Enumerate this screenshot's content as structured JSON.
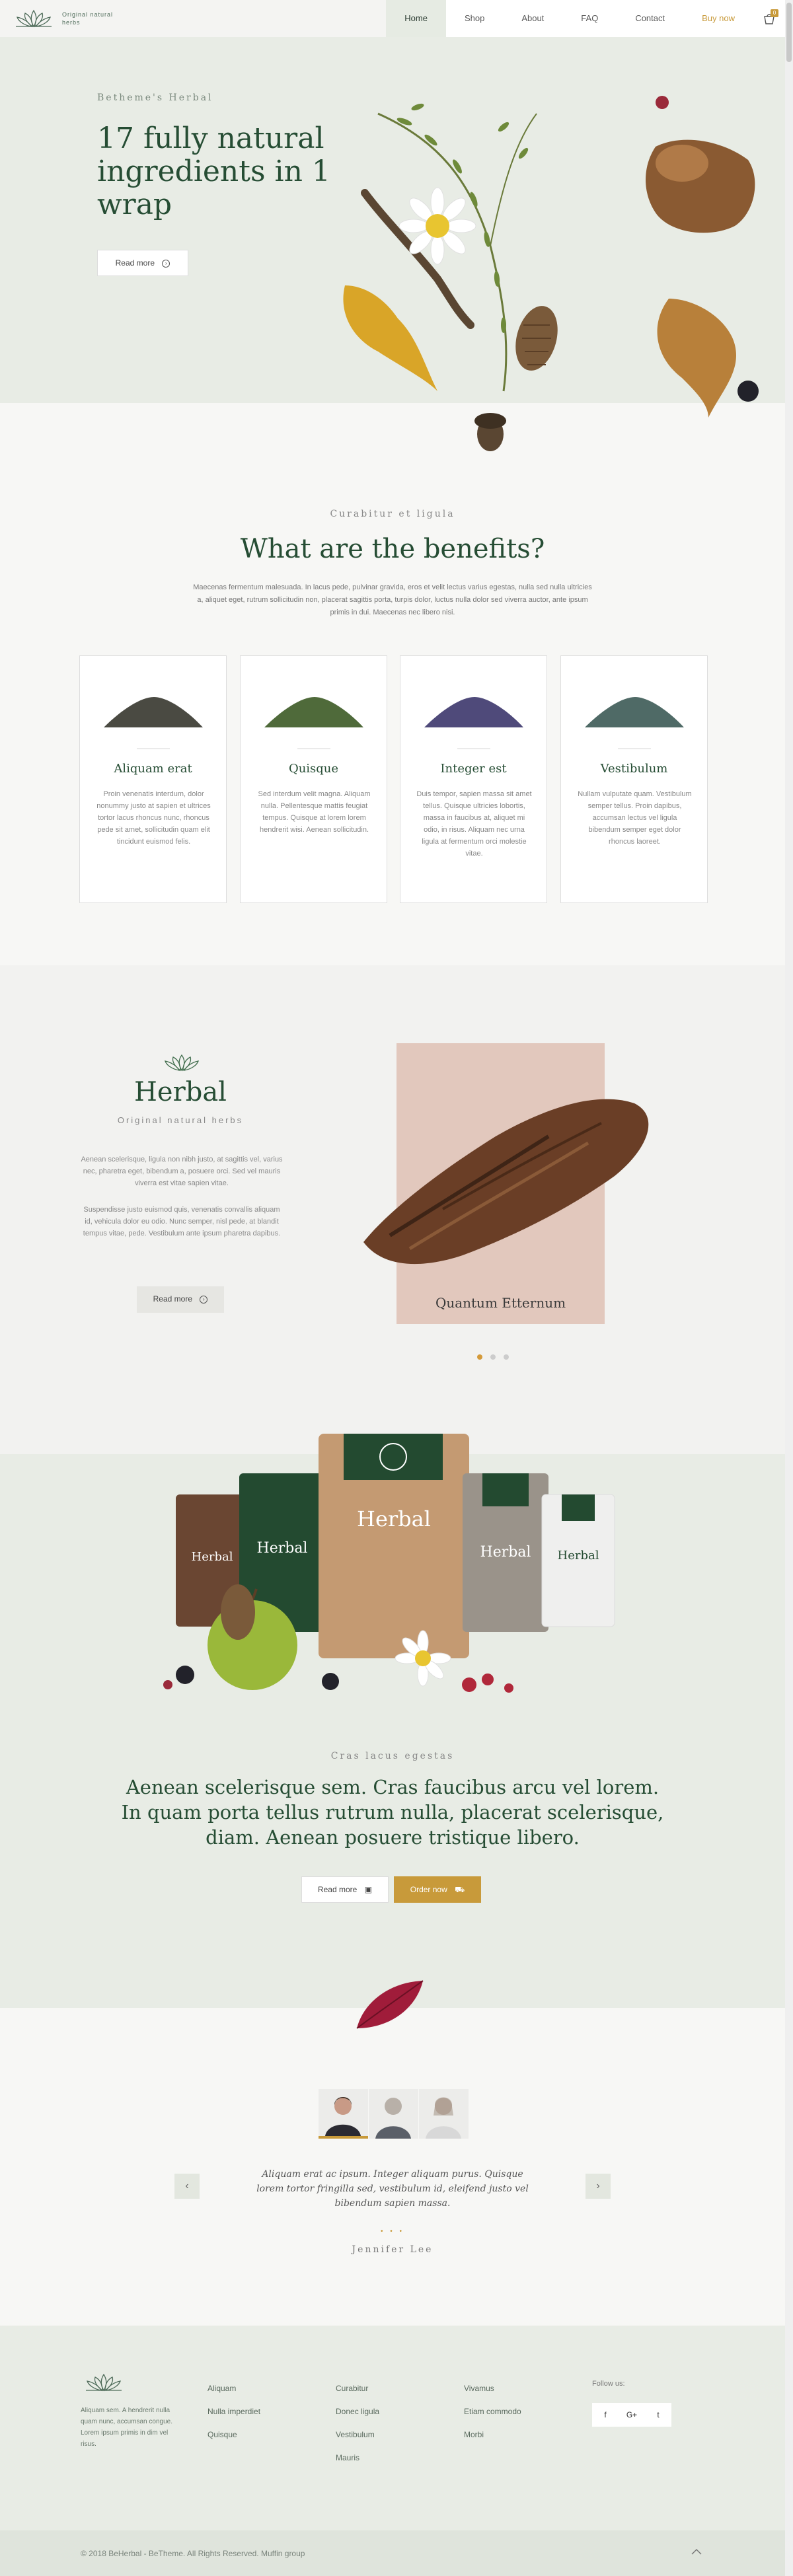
{
  "header": {
    "logo_text": "Original natural herbs",
    "nav": [
      "Home",
      "Shop",
      "About",
      "FAQ",
      "Contact",
      "Buy now"
    ],
    "cart_count": "0"
  },
  "hero": {
    "kicker": "Betheme's Herbal",
    "title": "17 fully natural ingredients in 1 wrap",
    "button": "Read more"
  },
  "benefits": {
    "kicker": "Curabitur et ligula",
    "title": "What are the benefits?",
    "description": "Maecenas fermentum malesuada. In lacus pede, pulvinar gravida, eros et velit lectus varius egestas, nulla sed nulla ultricies a, aliquet eget, rutrum sollicitudin non, placerat sagittis porta, turpis dolor, luctus nulla dolor sed viverra auctor, ante ipsum primis in dui. Maecenas nec libero nisi.",
    "cards": [
      {
        "title": "Aliquam erat",
        "text": "Proin venenatis interdum, dolor nonummy justo at sapien et ultrices tortor lacus rhoncus nunc, rhoncus pede sit amet, sollicitudin quam elit tincidunt euismod felis.",
        "herb_color": "#4a4a42"
      },
      {
        "title": "Quisque",
        "text": "Sed interdum velit magna. Aliquam nulla. Pellentesque mattis feugiat tempus. Quisque at lorem lorem hendrerit wisi. Aenean sollicitudin.",
        "herb_color": "#4f6a3a"
      },
      {
        "title": "Integer est",
        "text": "Duis tempor, sapien massa sit amet tellus. Quisque ultricies lobortis, massa in faucibus at, aliquet mi odio, in risus. Aliquam nec urna ligula at fermentum orci molestie vitae.",
        "herb_color": "#4f4a7a"
      },
      {
        "title": "Vestibulum",
        "text": "Nullam vulputate quam. Vestibulum semper tellus. Proin dapibus, accumsan lectus vel ligula bibendum semper eget dolor rhoncus laoreet.",
        "herb_color": "#4f6a66"
      }
    ]
  },
  "brand": {
    "title": "Herbal",
    "subtitle": "Original natural herbs",
    "paragraph1": "Aenean scelerisque, ligula non nibh justo, at sagittis vel, varius nec, pharetra eget, bibendum a, posuere orci. Sed vel mauris viverra est vitae sapien vitae.",
    "paragraph2": "Suspendisse justo euismod quis, venenatis convallis aliquam id, vehicula dolor eu odio. Nunc semper, nisl pede, at blandit tempus vitae, pede. Vestibulum ante ipsum pharetra dapibus.",
    "button": "Read more",
    "slide_caption": "Quantum Etternum",
    "slide_count": 3,
    "active_slide": 1
  },
  "packages": {
    "kicker": "Cras lacus egestas",
    "title": "Aenean scelerisque sem. Cras faucibus arcu vel lorem. In quam porta tellus rutrum nulla, placerat scelerisque, diam. Aenean posuere tristique libero.",
    "read_button": "Read more",
    "order_button": "Order now",
    "package_label": "Herbal"
  },
  "testimonial": {
    "quote": "Aliquam erat ac ipsum. Integer aliquam purus. Quisque lorem tortor fringilla sed, vestibulum id, eleifend justo vel bibendum sapien massa.",
    "stars": "• • •",
    "author": "Jennifer Lee",
    "prev": "‹",
    "next": "›"
  },
  "footer": {
    "about": "Aliquam sem. A hendrerit nulla quam nunc, accumsan congue. Lorem ipsum primis in dim vel risus.",
    "col1": [
      "Aliquam",
      "Nulla imperdiet",
      "Quisque"
    ],
    "col2": [
      "Curabitur",
      "Donec ligula",
      "Vestibulum",
      "Mauris"
    ],
    "col3": [
      "Vivamus",
      "Etiam commodo",
      "Morbi"
    ],
    "follow_label": "Follow us:",
    "socials": [
      "f",
      "G+",
      "t"
    ],
    "copyright": "© 2018 BeHerbal - BeTheme. All Rights Reserved. Muffin group"
  },
  "colors": {
    "accent": "#c89a3a",
    "brand_green": "#264d34",
    "hero_bg": "#e8ece5"
  }
}
